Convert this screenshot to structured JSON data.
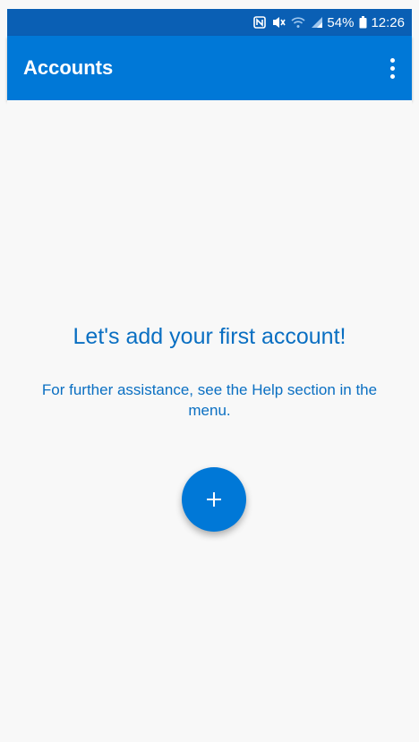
{
  "status_bar": {
    "nfc_icon": "nfc-icon",
    "mute_icon": "vibrate-off-icon",
    "wifi_icon": "wifi-icon",
    "signal_icon": "signal-icon",
    "battery_percent": "54%",
    "battery_icon": "battery-icon",
    "time": "12:26"
  },
  "app_bar": {
    "title": "Accounts",
    "menu_icon": "more-vert-icon"
  },
  "empty_state": {
    "headline": "Let's add your first account!",
    "help_text": "For further assistance, see the Help section in the menu."
  },
  "fab": {
    "icon": "plus-icon"
  },
  "colors": {
    "status_bar": "#0a5fb4",
    "app_bar": "#0078d7",
    "accent_text": "#0a6fc2",
    "background": "#f8f8f8"
  }
}
